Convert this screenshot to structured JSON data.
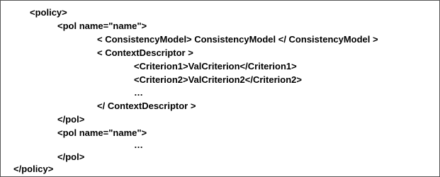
{
  "document": {
    "lines": [
      "<policy>",
      "<pol name=\"name\">",
      "< ConsistencyModel> ConsistencyModel </ ConsistencyModel >",
      "< ContextDescriptor >",
      "<Criterion1>ValCriterion</Criterion1>",
      "<Criterion2>ValCriterion2</Criterion2>",
      "…",
      "</ ContextDescriptor >",
      "</pol>",
      "<pol name=\"name\">",
      "…",
      "</pol>",
      "</policy>"
    ]
  },
  "colors": {
    "text": "#000000",
    "border": "#555555",
    "background": "#ffffff"
  }
}
